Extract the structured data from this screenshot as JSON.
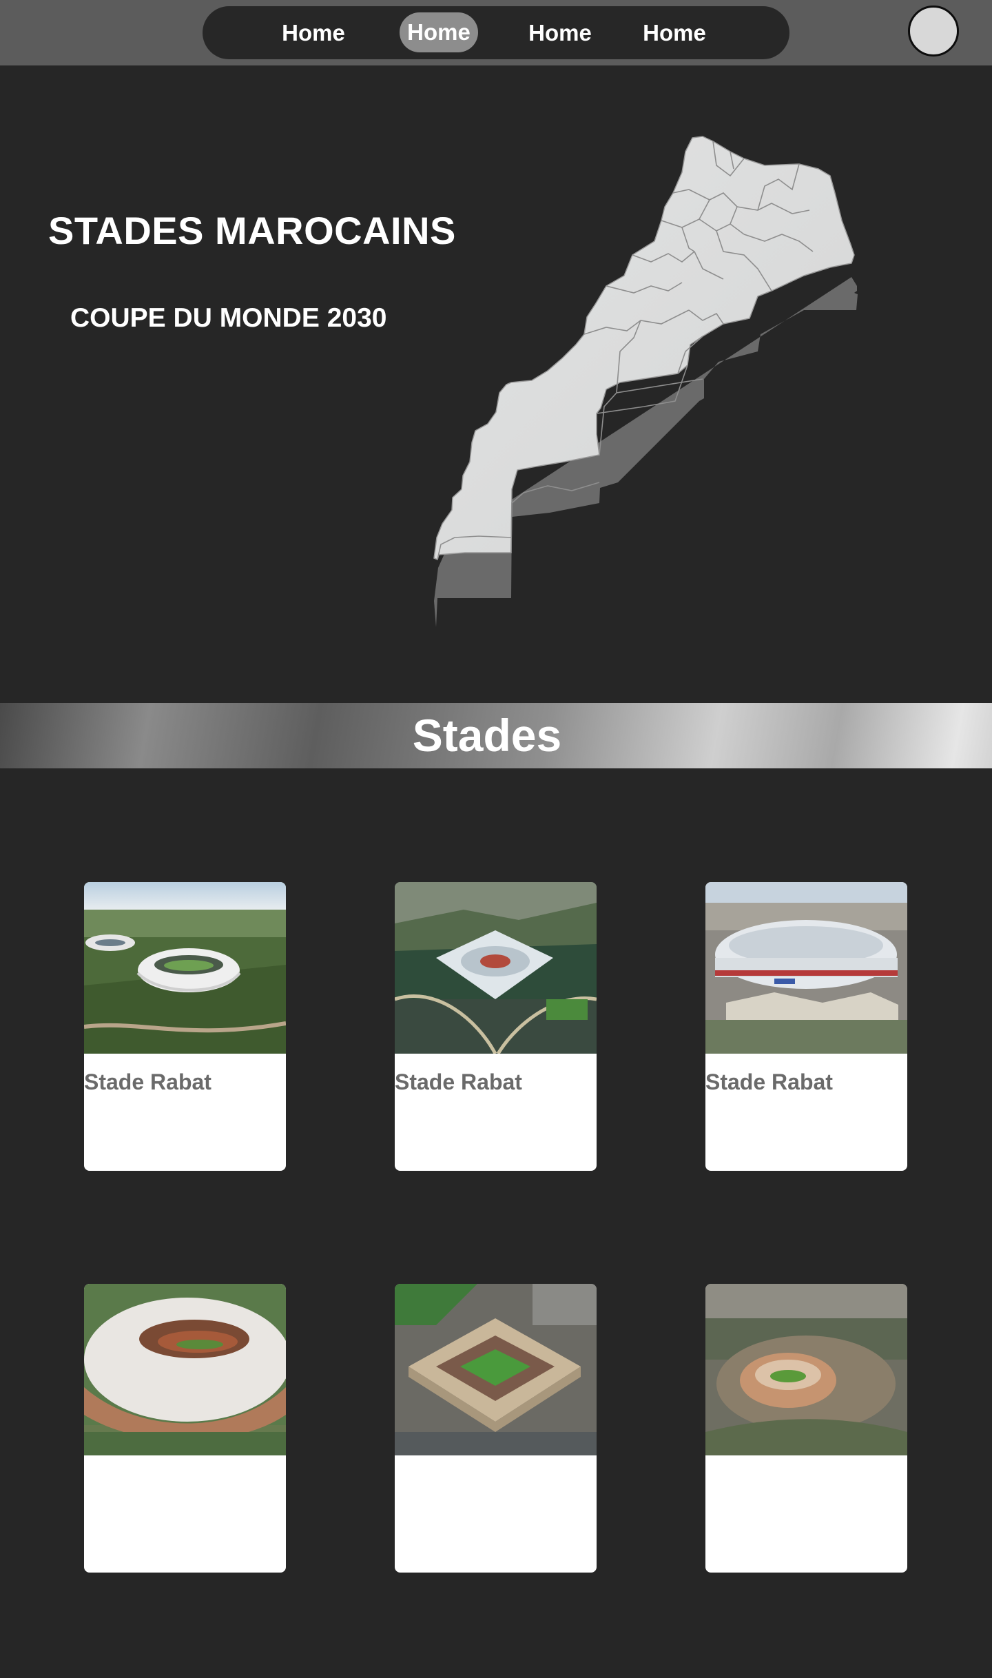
{
  "nav": {
    "items": [
      {
        "label": "Home"
      },
      {
        "label": "Home"
      },
      {
        "label": "Home"
      },
      {
        "label": "Home"
      }
    ],
    "active_index": 1
  },
  "hero": {
    "title": "STADES MAROCAINS",
    "subtitle": "COUPE DU MONDE 2030",
    "map_icon": "morocco-map"
  },
  "section": {
    "title": "Stades"
  },
  "stadiums": [
    {
      "name": "Stade Rabat"
    },
    {
      "name": "Stade Rabat"
    },
    {
      "name": "Stade Rabat"
    },
    {
      "name": ""
    },
    {
      "name": ""
    },
    {
      "name": ""
    }
  ],
  "colors": {
    "background": "#262626",
    "topbar": "#5c5c5c",
    "nav_pill": "#272727",
    "nav_active": "#8d8d8d",
    "avatar": "#d8d8d8",
    "map_fill": "#dcdddd",
    "card_title": "#6a6a6a"
  }
}
